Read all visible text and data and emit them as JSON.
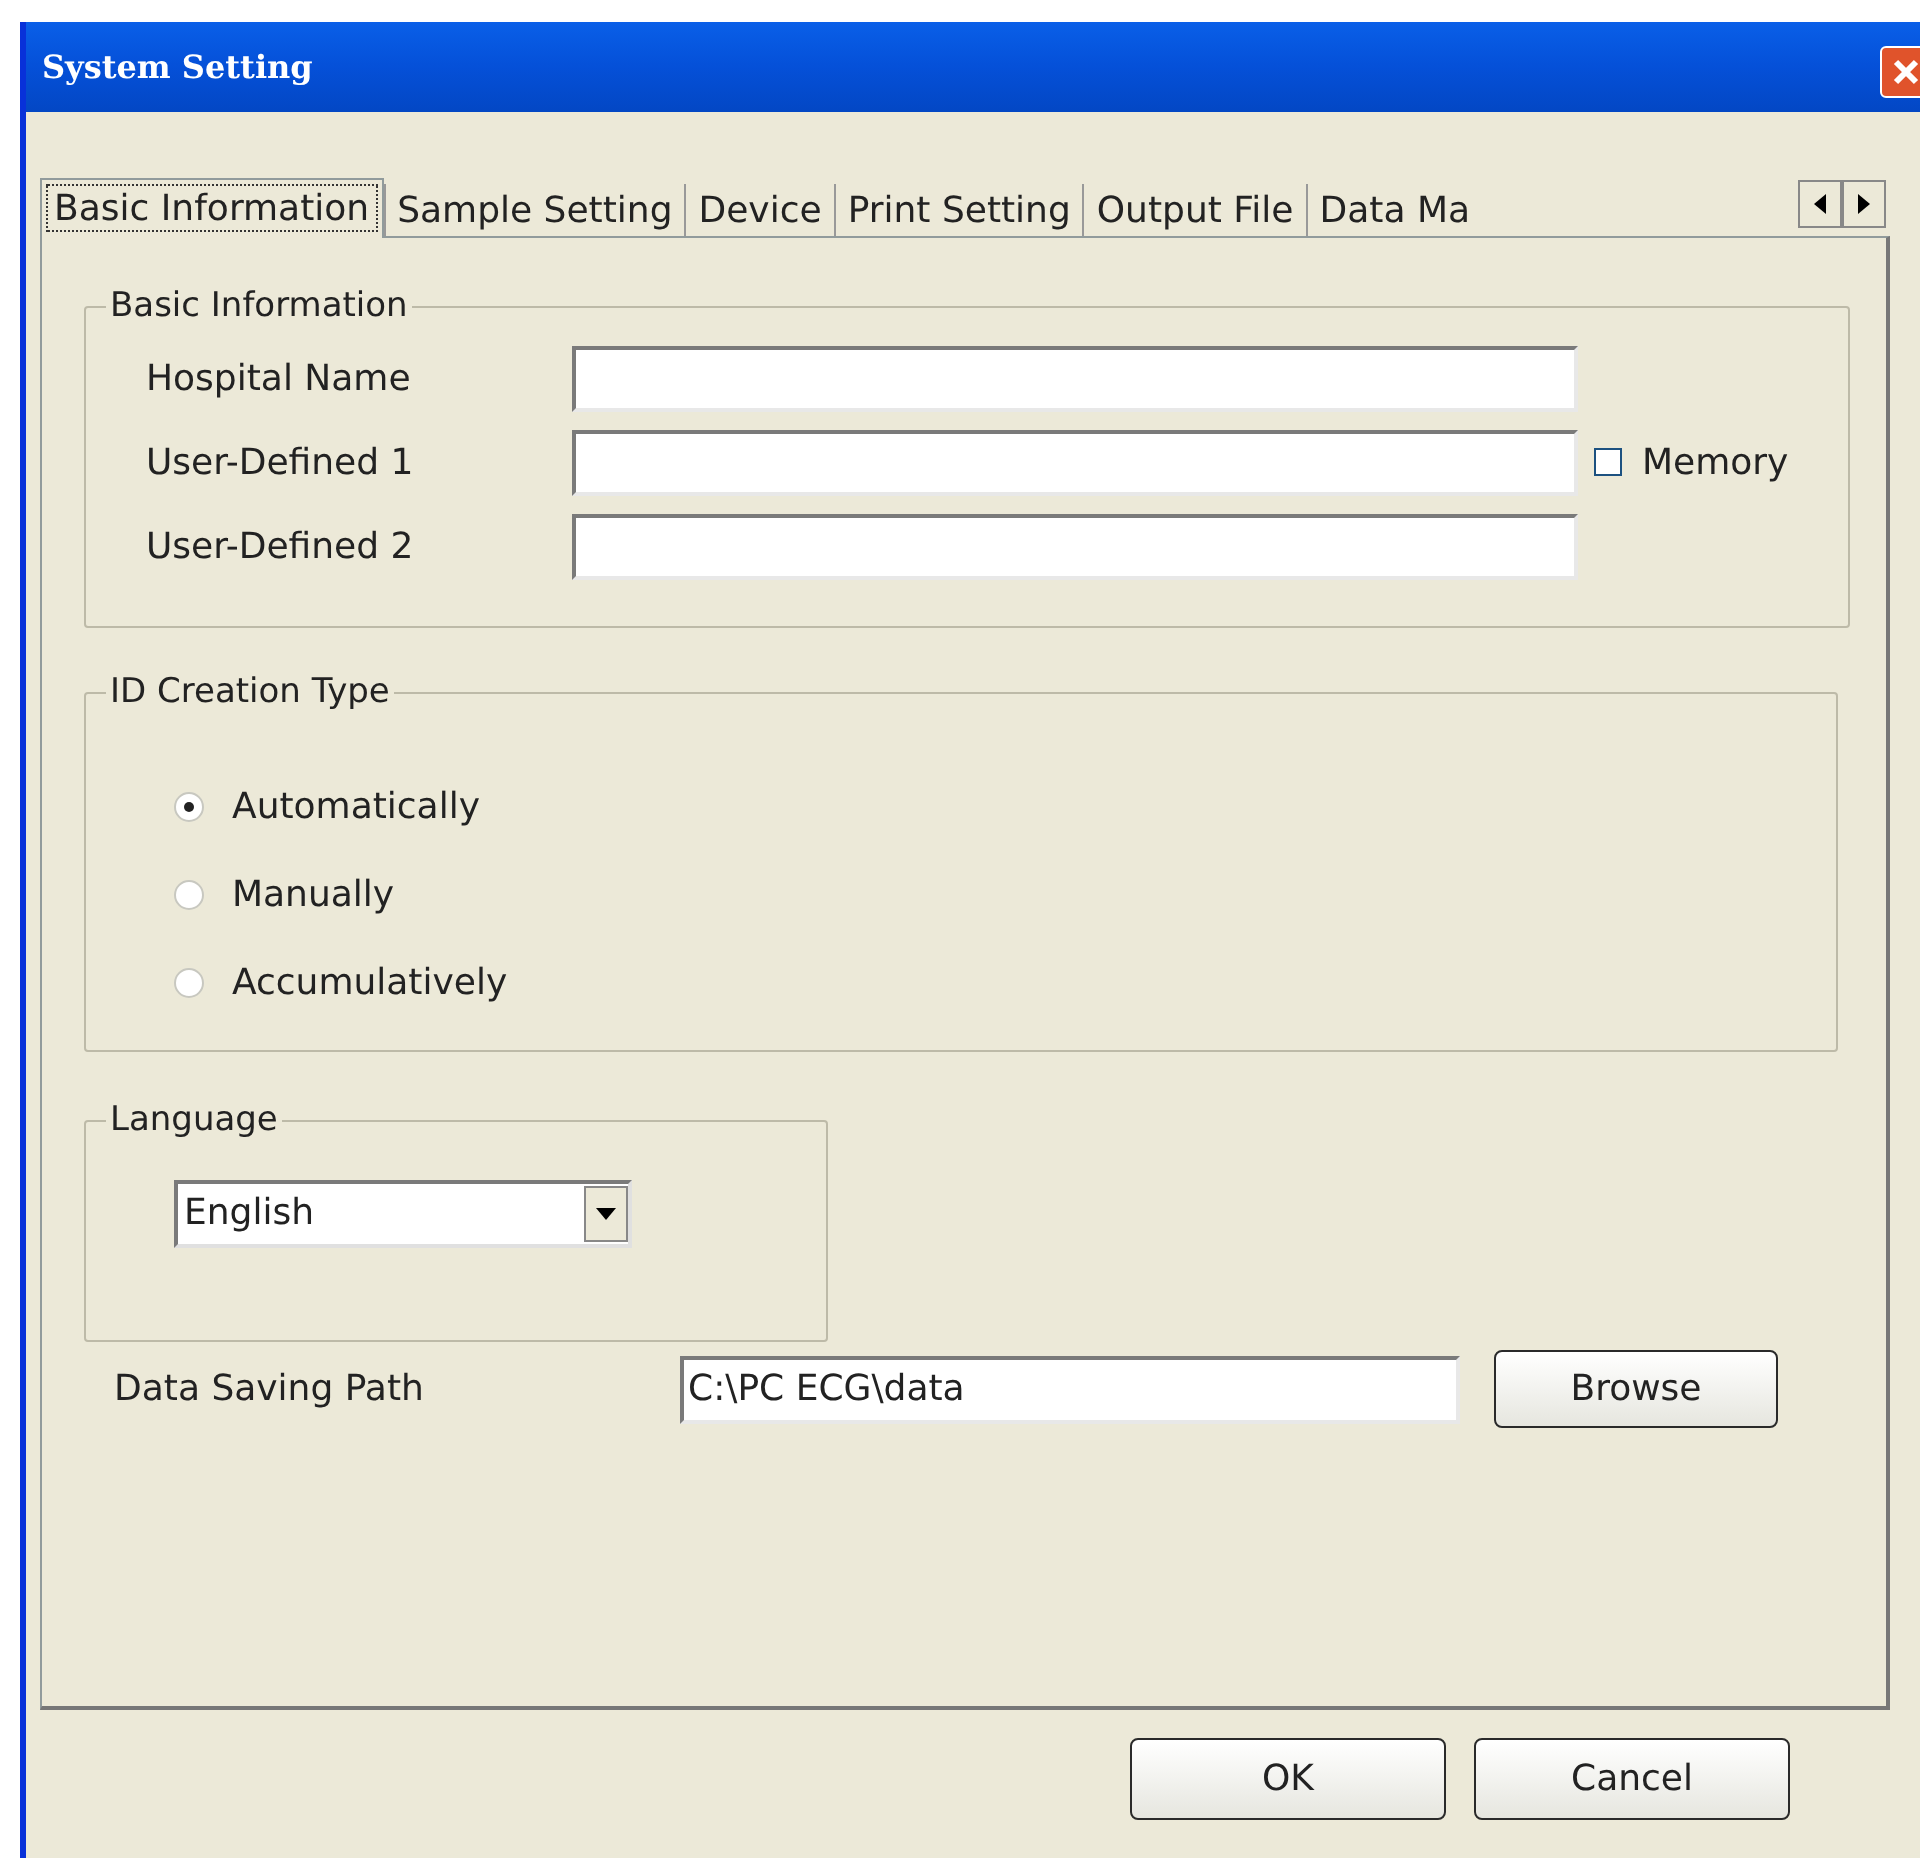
{
  "window": {
    "title": "System Setting"
  },
  "tabs": [
    {
      "label": "Basic Information",
      "selected": true
    },
    {
      "label": "Sample Setting",
      "selected": false
    },
    {
      "label": "Device",
      "selected": false
    },
    {
      "label": "Print Setting",
      "selected": false
    },
    {
      "label": "Output File",
      "selected": false
    },
    {
      "label": "Data Ma",
      "selected": false
    }
  ],
  "basic_information": {
    "title": "Basic Information",
    "fields": [
      {
        "label": "Hospital Name"
      },
      {
        "label": "User-Defined 1"
      },
      {
        "label": "User-Defined 2"
      }
    ],
    "memory": {
      "label": "Memory",
      "checked": false
    }
  },
  "id_creation_type": {
    "title": "ID Creation Type",
    "options": [
      {
        "label": "Automatically",
        "selected": true
      },
      {
        "label": "Manually",
        "selected": false
      },
      {
        "label": "Accumulatively",
        "selected": false
      }
    ]
  },
  "language": {
    "title": "Language",
    "value": "English"
  },
  "data_saving_path": {
    "label": "Data Saving Path",
    "value": "C:\\PC ECG\\data",
    "button": "Browse"
  },
  "buttons": [
    "OK",
    "Cancel"
  ]
}
